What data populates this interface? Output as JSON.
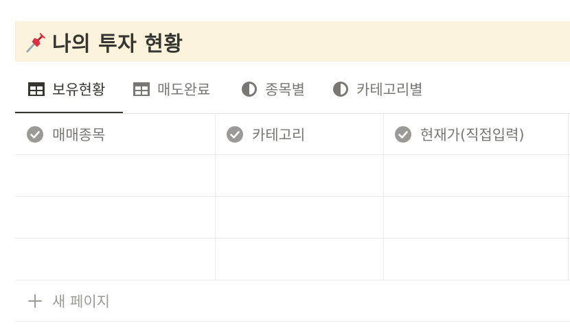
{
  "page": {
    "title": "나의 투자 현황",
    "icon": "pushpin-icon",
    "header_bg": "#fbf3db"
  },
  "tabs": [
    {
      "label": "보유현황",
      "icon": "table-icon",
      "active": true
    },
    {
      "label": "매도완료",
      "icon": "table-icon",
      "active": false
    },
    {
      "label": "종목별",
      "icon": "chart-icon",
      "active": false
    },
    {
      "label": "카테고리별",
      "icon": "chart-icon",
      "active": false
    }
  ],
  "table": {
    "columns": [
      {
        "label": "매매종목",
        "icon": "checkmark-circle-icon"
      },
      {
        "label": "카테고리",
        "icon": "checkmark-circle-icon"
      },
      {
        "label": "현재가(직접입력)",
        "icon": "checkmark-circle-icon"
      }
    ],
    "rows": [
      [
        "",
        "",
        ""
      ],
      [
        "",
        "",
        ""
      ],
      [
        "",
        "",
        ""
      ]
    ]
  },
  "new_page": {
    "label": "새 페이지",
    "icon": "plus-icon"
  }
}
